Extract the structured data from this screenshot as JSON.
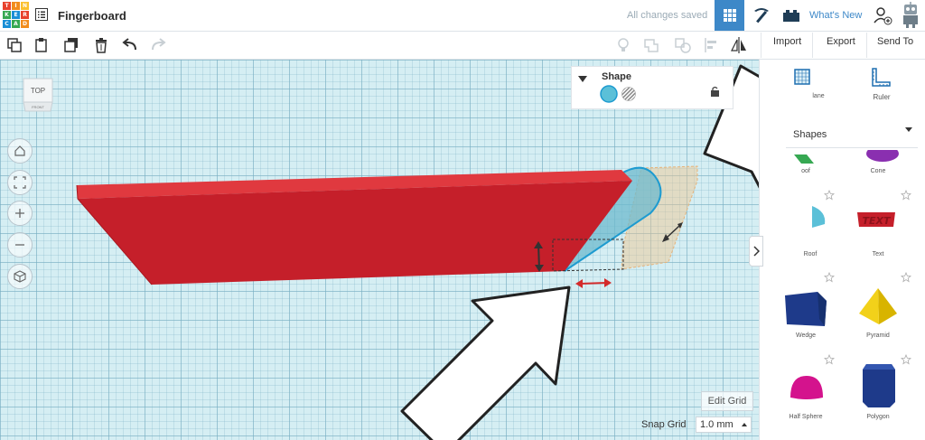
{
  "app": {
    "logo_letters": [
      "T",
      "I",
      "N",
      "K",
      "E",
      "R",
      "C",
      "A",
      "D"
    ],
    "logo_colors": [
      "#e8412c",
      "#f28c1c",
      "#fbc02d",
      "#36a852",
      "#1a8fd6",
      "#e8412c",
      "#1a8fd6",
      "#36a852",
      "#f28c1c"
    ],
    "document_title": "Fingerboard",
    "status_text": "All changes saved",
    "whats_new": "What's New"
  },
  "toolbar": {
    "import_label": "Import",
    "export_label": "Export",
    "send_to_label": "Send To"
  },
  "shape_inspector": {
    "title": "Shape",
    "solid_color": "#5bc0d8",
    "hole_label": "hole"
  },
  "viewcube": {
    "top": "TOP",
    "front": "FRONT"
  },
  "right_panel": {
    "workplane_label": "lane",
    "ruler_label": "Ruler",
    "category_label": "Shapes",
    "shapes": [
      {
        "label": "oof"
      },
      {
        "label": "Cone"
      },
      {
        "label": "Roof"
      },
      {
        "label": "Text"
      },
      {
        "label": "Wedge"
      },
      {
        "label": "Pyramid"
      },
      {
        "label": "Half Sphere"
      },
      {
        "label": "Polygon"
      }
    ]
  },
  "grid": {
    "edit_grid_label": "Edit Grid",
    "snap_grid_label": "Snap Grid",
    "snap_grid_value": "1.0 mm"
  },
  "colors": {
    "accent_blue": "#3d88c8",
    "shape_red": "#c51f2a",
    "shape_red_top": "#e0393f"
  }
}
